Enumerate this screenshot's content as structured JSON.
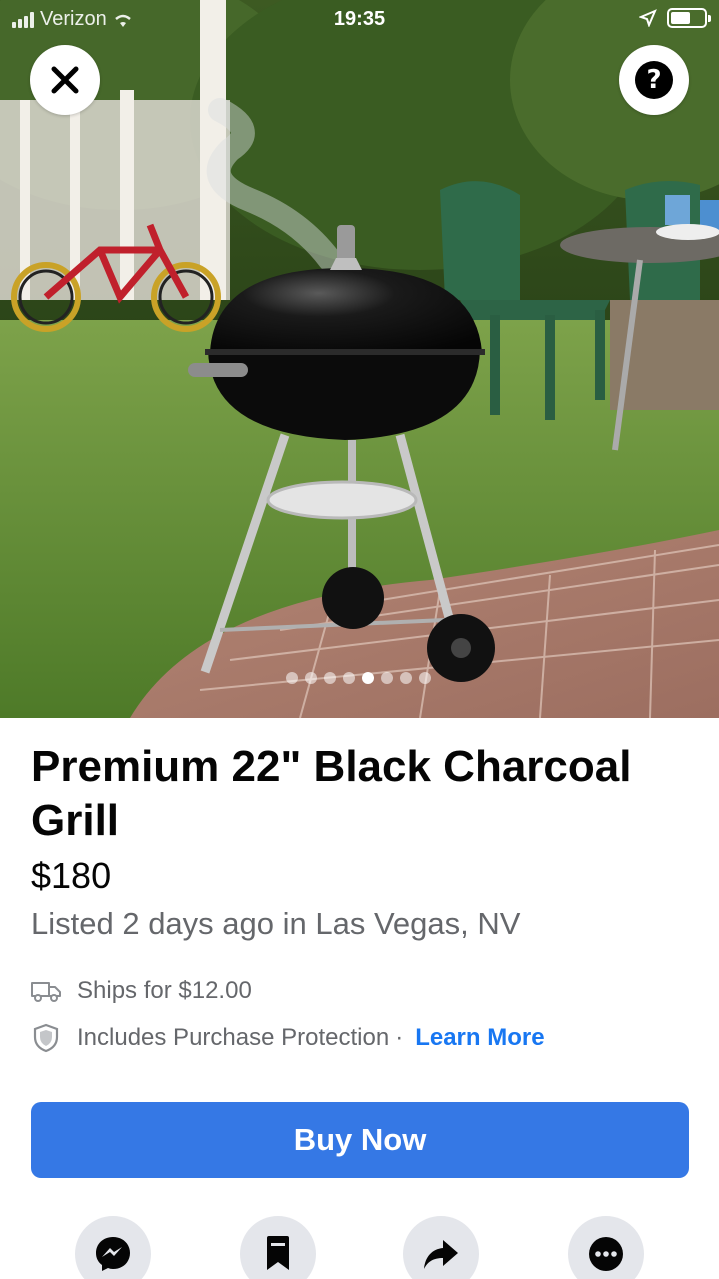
{
  "status_bar": {
    "carrier": "Verizon",
    "time": "19:35",
    "battery_level": 0.6
  },
  "hero": {
    "image_subject": "black charcoal kettle grill on brick patio",
    "photo_count": 8,
    "active_photo_index": 4,
    "close_icon": "close-icon",
    "help_icon": "question-icon"
  },
  "listing": {
    "title": "Premium 22\" Black Charcoal Grill",
    "price": "$180",
    "listed": "Listed 2 days ago in Las Vegas, NV",
    "shipping": "Ships for $12.00",
    "protection": "Includes Purchase Protection",
    "separator": "·",
    "learn_more": "Learn More",
    "buy_now": "Buy Now"
  },
  "actions": [
    {
      "name": "message",
      "icon": "messenger-icon"
    },
    {
      "name": "save",
      "icon": "bookmark-icon"
    },
    {
      "name": "share",
      "icon": "share-icon"
    },
    {
      "name": "more",
      "icon": "more-icon"
    }
  ],
  "colors": {
    "accent": "#3578e5",
    "link": "#1877f2",
    "secondary_text": "#65676b",
    "action_bg": "#e4e6eb"
  }
}
